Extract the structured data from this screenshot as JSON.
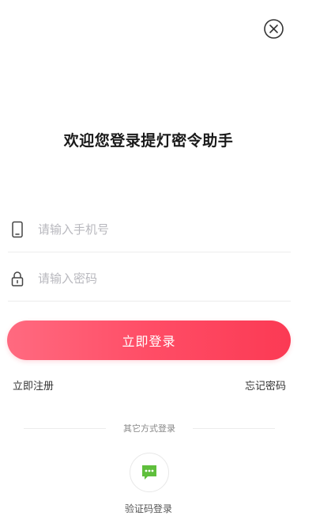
{
  "header": {
    "close_icon": "close-circle-icon"
  },
  "title": "欢迎您登录提灯密令助手",
  "form": {
    "phone": {
      "icon": "phone-icon",
      "placeholder": "请输入手机号",
      "value": ""
    },
    "password": {
      "icon": "lock-icon",
      "placeholder": "请输入密码",
      "value": ""
    },
    "login_label": "立即登录"
  },
  "links": {
    "register": "立即注册",
    "forgot_password": "忘记密码"
  },
  "other_login": {
    "divider_text": "其它方式登录",
    "sms": {
      "icon": "sms-chat-icon",
      "label": "验证码登录"
    }
  },
  "colors": {
    "accent_start": "#ff6a80",
    "accent_end": "#fb3a54",
    "sms_icon": "#5fbf3c"
  }
}
